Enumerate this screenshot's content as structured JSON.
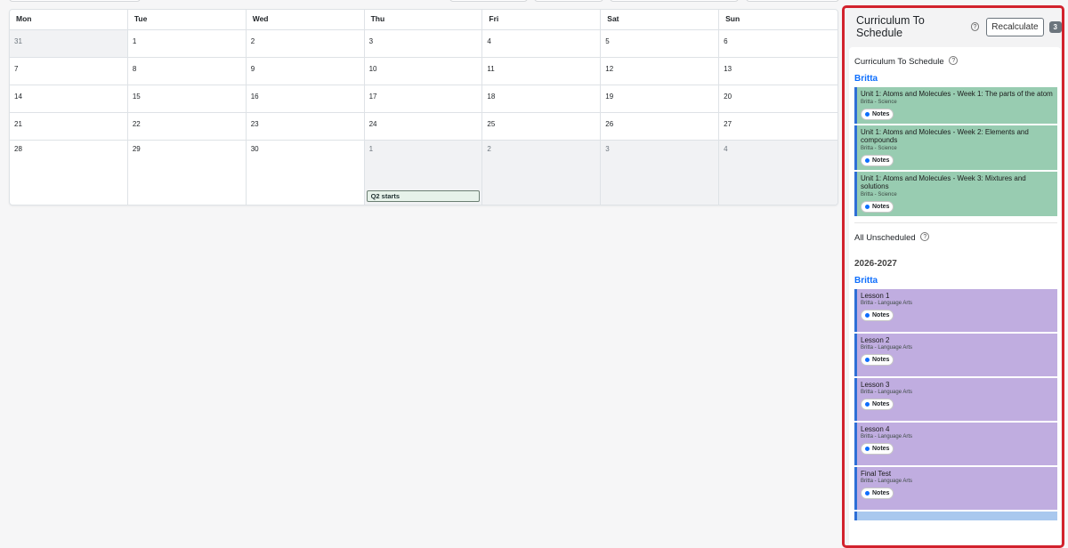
{
  "calendar": {
    "day_headers": [
      "Mon",
      "Tue",
      "Wed",
      "Thu",
      "Fri",
      "Sat",
      "Sun"
    ],
    "weeks": [
      [
        "31",
        "1",
        "2",
        "3",
        "4",
        "5",
        "6"
      ],
      [
        "7",
        "8",
        "9",
        "10",
        "11",
        "12",
        "13"
      ],
      [
        "14",
        "15",
        "16",
        "17",
        "18",
        "19",
        "20"
      ],
      [
        "21",
        "22",
        "23",
        "24",
        "25",
        "26",
        "27"
      ],
      [
        "28",
        "29",
        "30",
        "1",
        "2",
        "3",
        "4"
      ]
    ],
    "event_q2": "Q2 starts"
  },
  "panel": {
    "title": "Curriculum To Schedule",
    "help": "?",
    "recalculate": "Recalculate",
    "count": "3",
    "section1_title": "Curriculum To Schedule",
    "section1_student": "Britta",
    "section1_items": [
      {
        "title": "Unit 1: Atoms and Molecules - Week 1: The parts of the atom",
        "sub": "Britta - Science"
      },
      {
        "title": "Unit 1: Atoms and Molecules - Week 2: Elements and compounds",
        "sub": "Britta - Science"
      },
      {
        "title": "Unit 1: Atoms and Molecules - Week 3: Mixtures and solutions",
        "sub": "Britta - Science"
      }
    ],
    "section2_title": "All Unscheduled",
    "year": "2026-2027",
    "section2_student": "Britta",
    "section2_items": [
      {
        "title": "Lesson 1",
        "sub": "Britta - Language Arts"
      },
      {
        "title": "Lesson 2",
        "sub": "Britta - Language Arts"
      },
      {
        "title": "Lesson 3",
        "sub": "Britta - Language Arts"
      },
      {
        "title": "Lesson 4",
        "sub": "Britta - Language Arts"
      },
      {
        "title": "Final Test",
        "sub": "Britta - Language Arts"
      }
    ],
    "notes_label": "Notes"
  }
}
